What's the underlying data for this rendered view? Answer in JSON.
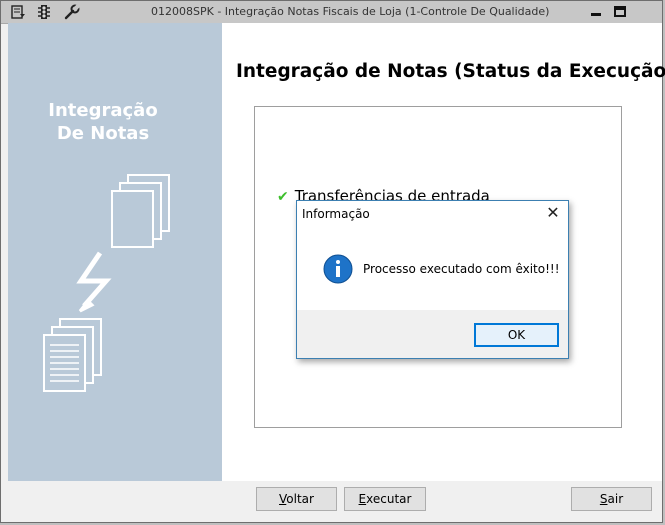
{
  "window": {
    "title": "012008SPK - Integração Notas Fiscais de Loja (1-Controle De Qualidade)"
  },
  "sidebar": {
    "title_line1": "Integração",
    "title_line2": "De Notas"
  },
  "main": {
    "heading": "Integração de Notas (Status da Execução)",
    "status_items": [
      {
        "label": "Transferências de entrada",
        "status": "done"
      }
    ]
  },
  "footer": {
    "back_label": "Voltar",
    "back_mnemonic": "V",
    "execute_label": "Executar",
    "execute_mnemonic": "E",
    "exit_label": "Sair",
    "exit_mnemonic": "S"
  },
  "dialog": {
    "title": "Informação",
    "close_glyph": "✕",
    "message": "Processo executado com êxito!!!",
    "ok_label": "OK"
  },
  "colors": {
    "sidebar_bg": "#b9c9d8",
    "check": "#3dbf2c",
    "info_icon": "#1e73c8",
    "dialog_border": "#3c7fb1"
  }
}
